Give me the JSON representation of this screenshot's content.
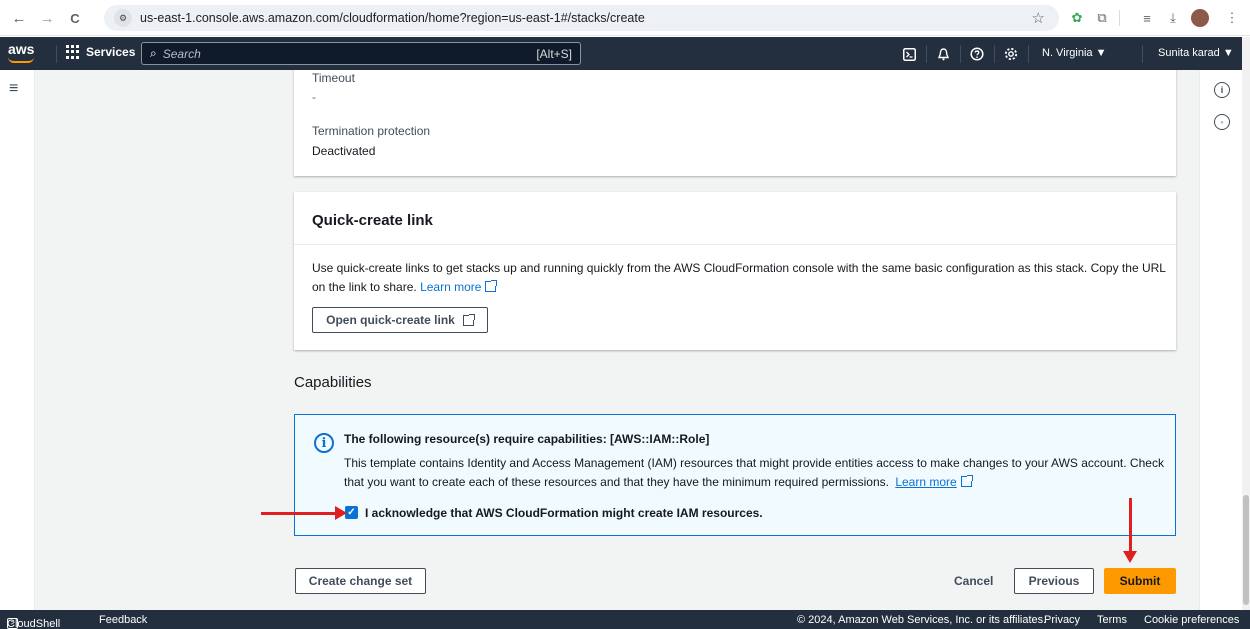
{
  "browser": {
    "back": "←",
    "forward": "→",
    "reload": "C",
    "site_info": "⚙",
    "url": "us-east-1.console.aws.amazon.com/cloudformation/home?region=us-east-1#/stacks/create",
    "star": "☆",
    "menu": "⋮"
  },
  "aws_nav": {
    "logo": "aws",
    "services_label": "Services",
    "search_placeholder": "Search",
    "search_shortcut": "[Alt+S]",
    "region": "N. Virginia ▼",
    "user": "Sunita karad ▼"
  },
  "details": {
    "timeout_label": "Timeout",
    "timeout_value": "-",
    "termination_label": "Termination protection",
    "termination_value": "Deactivated"
  },
  "quick_create": {
    "title": "Quick-create link",
    "description": "Use quick-create links to get stacks up and running quickly from the AWS CloudFormation console with the same basic configuration as this stack. Copy the URL on the link to share.",
    "learn_more": "Learn more",
    "button": "Open quick-create link"
  },
  "capabilities": {
    "title": "Capabilities",
    "alert_title": "The following resource(s) require capabilities: [AWS::IAM::Role]",
    "alert_body": "This template contains Identity and Access Management (IAM) resources that might provide entities access to make changes to your AWS account. Check that you want to create each of these resources and that they have the minimum required permissions.",
    "learn_more": "Learn more",
    "acknowledge_label": "I acknowledge that AWS CloudFormation might create IAM resources.",
    "acknowledged": true
  },
  "actions": {
    "create_change_set": "Create change set",
    "cancel": "Cancel",
    "previous": "Previous",
    "submit": "Submit"
  },
  "footer": {
    "cloudshell": "CloudShell",
    "feedback": "Feedback",
    "copyright": "© 2024, Amazon Web Services, Inc. or its affiliates.",
    "privacy": "Privacy",
    "terms": "Terms",
    "cookies": "Cookie preferences"
  },
  "colors": {
    "aws_nav": "#232f3e",
    "link": "#0972d3",
    "primary": "#ff9900",
    "annotation": "#e02020"
  }
}
